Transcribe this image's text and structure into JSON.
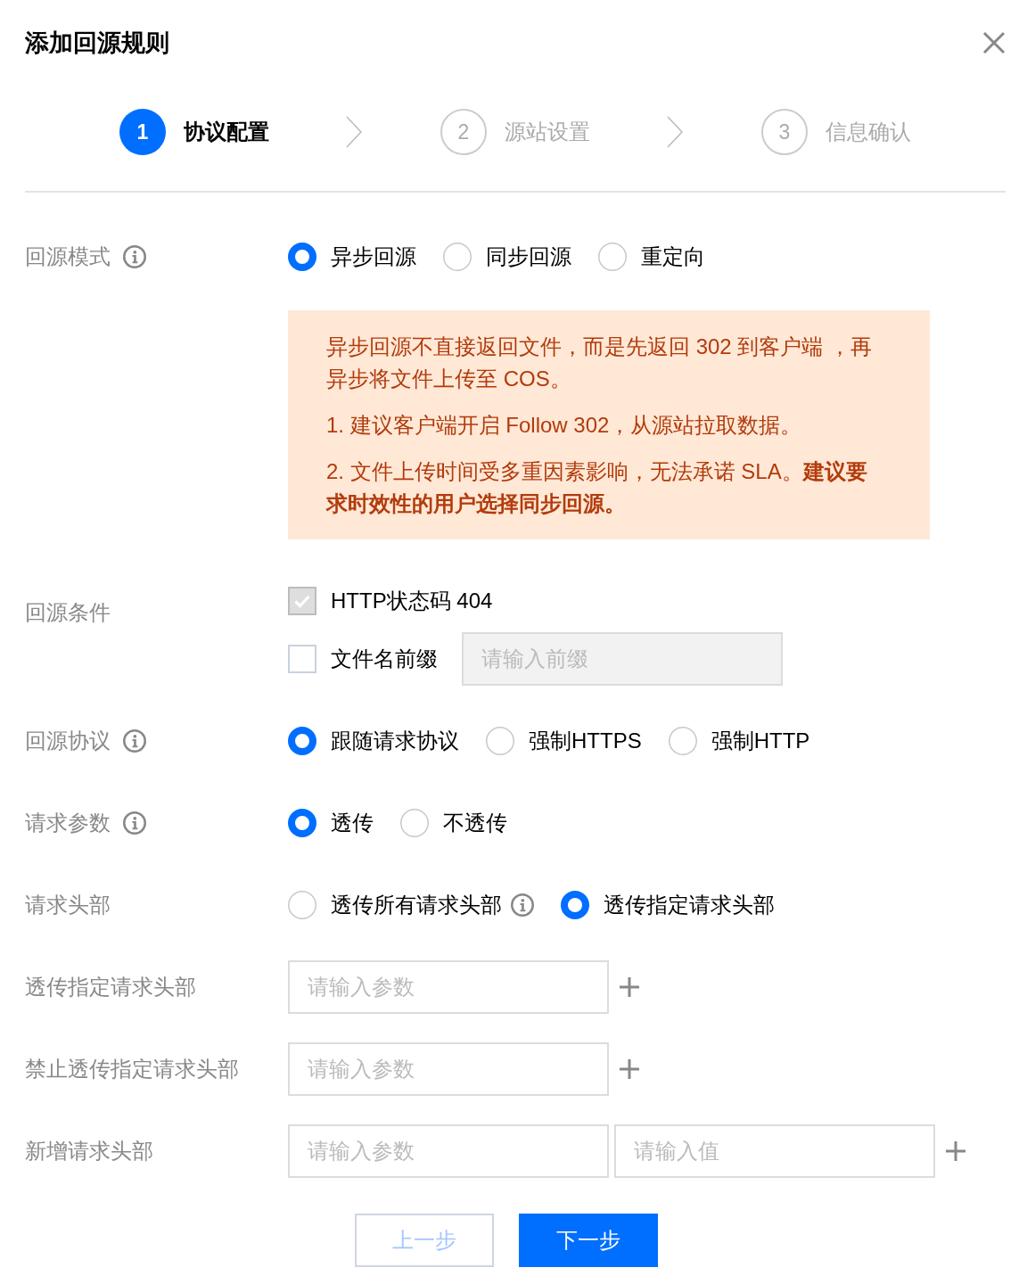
{
  "dialog": {
    "title": "添加回源规则"
  },
  "steps": [
    {
      "number": "1",
      "label": "协议配置",
      "selected": true
    },
    {
      "number": "2",
      "label": "源站设置",
      "selected": false
    },
    {
      "number": "3",
      "label": "信息确认",
      "selected": false
    }
  ],
  "form": [
    {
      "kind": "radio",
      "label": "回源模式",
      "info": true,
      "options": [
        {
          "label": "异步回源",
          "selected": true,
          "info": false
        },
        {
          "label": "同步回源",
          "selected": false,
          "info": false
        },
        {
          "label": "重定向",
          "selected": false,
          "info": false
        }
      ],
      "notice": [
        "异步回源不直接返回文件，而是先返回 302 到客户端 ，再异步将文件上传至 COS。",
        "1. 建议客户端开启 Follow 302，从源站拉取数据。",
        "2. 文件上传时间受多重因素影响，无法承诺 SLA。**建议要求时效性的用户选择同步回源。**"
      ]
    },
    {
      "kind": "checks",
      "label": "回源条件",
      "info": false,
      "items": [
        {
          "label": "HTTP状态码 404",
          "checked": true,
          "disabled": true
        },
        {
          "label": "文件名前缀",
          "checked": false,
          "disabled": false,
          "field": {
            "placeholder": "请输入前缀",
            "disabled": true
          }
        }
      ]
    },
    {
      "kind": "radio",
      "label": "回源协议",
      "info": true,
      "options": [
        {
          "label": "跟随请求协议",
          "selected": true,
          "info": false
        },
        {
          "label": "强制HTTPS",
          "selected": false,
          "info": false
        },
        {
          "label": "强制HTTP",
          "selected": false,
          "info": false
        }
      ]
    },
    {
      "kind": "radio",
      "label": "请求参数",
      "info": true,
      "options": [
        {
          "label": "透传",
          "selected": true,
          "info": false
        },
        {
          "label": "不透传",
          "selected": false,
          "info": false
        }
      ]
    },
    {
      "kind": "radio",
      "label": "请求头部",
      "info": false,
      "options": [
        {
          "label": "透传所有请求头部",
          "selected": false,
          "info": true
        },
        {
          "label": "透传指定请求头部",
          "selected": true,
          "info": false
        }
      ]
    },
    {
      "kind": "inputs",
      "label": "透传指定请求头部",
      "info": false,
      "fields": [
        {
          "placeholder": "请输入参数"
        }
      ]
    },
    {
      "kind": "inputs",
      "label": "禁止透传指定请求头部",
      "info": false,
      "fields": [
        {
          "placeholder": "请输入参数"
        }
      ]
    },
    {
      "kind": "inputs",
      "label": "新增请求头部",
      "info": false,
      "fields": [
        {
          "placeholder": "请输入参数"
        },
        {
          "placeholder": "请输入值"
        }
      ]
    }
  ],
  "buttons": [
    {
      "label": "上一步",
      "kind": "secondary",
      "disabled": true
    },
    {
      "label": "下一步",
      "kind": "primary",
      "disabled": false
    }
  ]
}
